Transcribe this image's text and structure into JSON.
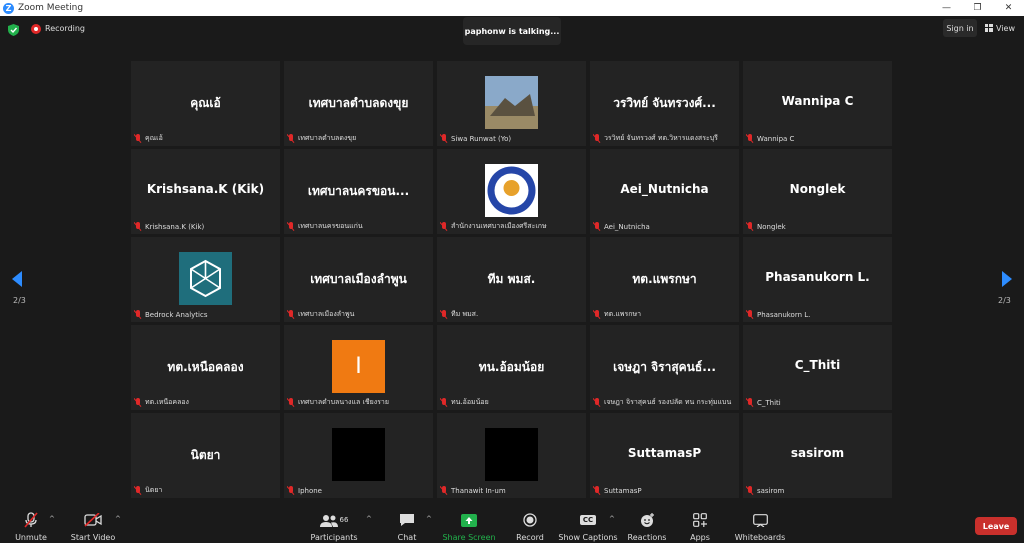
{
  "window": {
    "title": "Zoom Meeting",
    "app_logo": "Z"
  },
  "topbar": {
    "recording_label": "Recording",
    "talking": "paphonw is talking...",
    "sign_in": "Sign in",
    "view": "View"
  },
  "pager": {
    "left": "2/3",
    "right": "2/3"
  },
  "tiles": [
    {
      "big": "คุณเอ้",
      "name": "คุณเอ้"
    },
    {
      "big": "เทศบาลตำบลดงขุย",
      "name": "เทศบาลตำบลดงขุย"
    },
    {
      "big": "",
      "name": "Siwa Runwat (Yo)"
    },
    {
      "big": "วรวิทย์ จันทรวงศ์...",
      "name": "วรวิทย์ จันทรวงศ์ ทต.วิหารแดงสระบุรี"
    },
    {
      "big": "Wannipa C",
      "name": "Wannipa C"
    },
    {
      "big": "Krishsana.K (Kik)",
      "name": "Krishsana.K (Kik)"
    },
    {
      "big": "เทศบาลนครขอน...",
      "name": "เทศบาลนครขอนแก่น"
    },
    {
      "big": "",
      "name": "สำนักงานเทศบาลเมืองศรีสะเกษ"
    },
    {
      "big": "Aei_Nutnicha",
      "name": "Aei_Nutnicha"
    },
    {
      "big": "Nonglek",
      "name": "Nonglek"
    },
    {
      "big": "",
      "name": "Bedrock Analytics"
    },
    {
      "big": "เทศบาลเมืองลำพูน",
      "name": "เทศบาลเมืองลำพูน"
    },
    {
      "big": "ทีม พมส.",
      "name": "ทีม พมส."
    },
    {
      "big": "ทต.แพรกษา",
      "name": "ทต.แพรกษา"
    },
    {
      "big": "Phasanukorn L.",
      "name": "Phasanukorn L."
    },
    {
      "big": "ทต.เหนือคลอง",
      "name": "ทต.เหนือคลอง"
    },
    {
      "big": "",
      "name": "เทศบาลตำบลนางแล เชียงราย",
      "avatar_letter": "I"
    },
    {
      "big": "ทน.อ้อมน้อย",
      "name": "ทน.อ้อมน้อย"
    },
    {
      "big": "เจษฎา จิราสุคนธ์...",
      "name": "เจษฎา จิราสุคนธ์ รองปลัด ทน กระทุ่มแบน"
    },
    {
      "big": "C_Thiti",
      "name": "C_Thiti"
    },
    {
      "big": "นิตยา",
      "name": "นิตยา"
    },
    {
      "big": "",
      "name": "Iphone"
    },
    {
      "big": "",
      "name": "Thanawit In-um"
    },
    {
      "big": "SuttamasP",
      "name": "SuttamasP"
    },
    {
      "big": "sasirom",
      "name": "sasirom"
    }
  ],
  "toolbar": {
    "unmute": "Unmute",
    "start_video": "Start Video",
    "participants": "Participants",
    "participants_count": "66",
    "chat": "Chat",
    "share_screen": "Share Screen",
    "record": "Record",
    "show_captions": "Show Captions",
    "captions_badge": "CC",
    "reactions": "Reactions",
    "apps": "Apps",
    "whiteboards": "Whiteboards",
    "leave": "Leave"
  },
  "colors": {
    "accent": "#2d8cff",
    "leave": "#c9302c",
    "share": "#22b14c",
    "muted": "#e02828"
  }
}
